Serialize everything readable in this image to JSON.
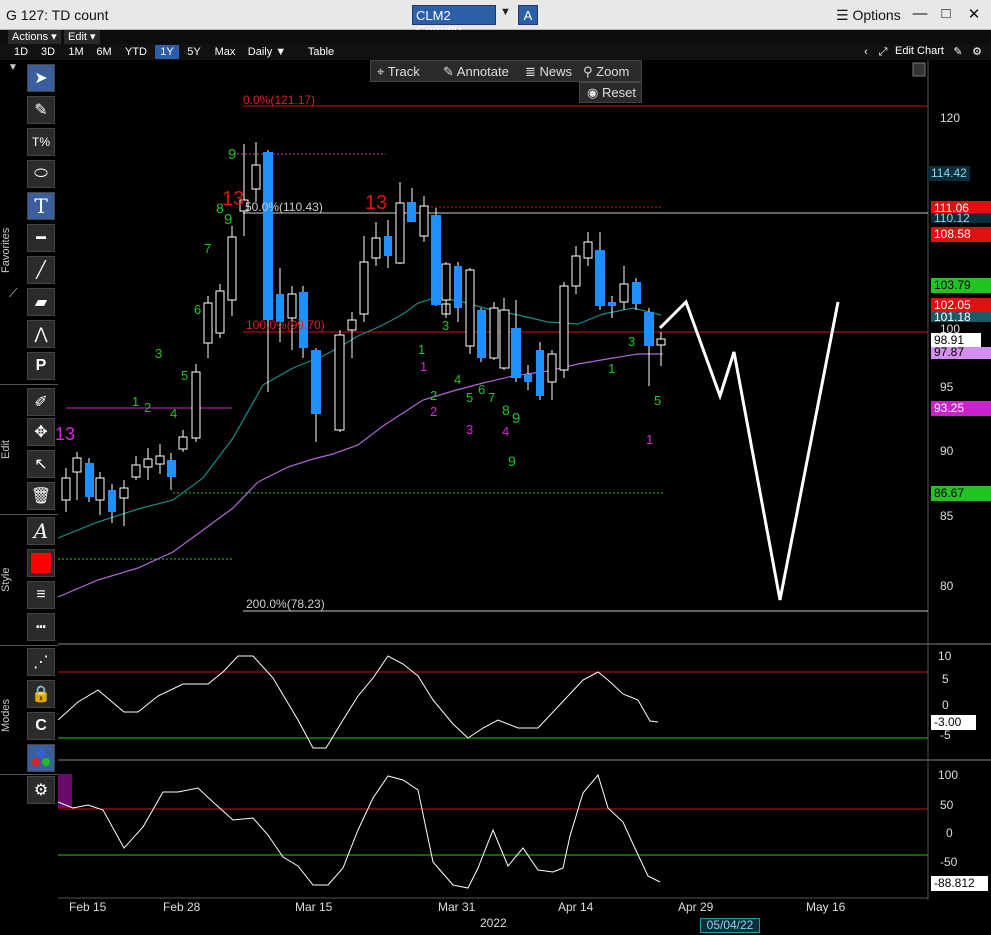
{
  "window": {
    "title": "G 127: TD count",
    "ticker": "CLM2 Comdty",
    "badge": "A",
    "options_label": "Options",
    "minimize_label": "□",
    "close_label": "✕"
  },
  "menu": {
    "actions": "Actions ▾",
    "edit": "Edit ▾"
  },
  "periods": [
    {
      "label": "1D"
    },
    {
      "label": "3D"
    },
    {
      "label": "1M"
    },
    {
      "label": "6M"
    },
    {
      "label": "YTD"
    },
    {
      "label": "1Y"
    },
    {
      "label": "5Y"
    },
    {
      "label": "Max"
    }
  ],
  "frequency": "Daily ▼",
  "table_label": "Table",
  "edit_chart_label": "Edit Chart",
  "toolbar_labels": {
    "favorites": "Favorites",
    "edit": "Edit",
    "style": "Style",
    "modes": "Modes"
  },
  "chart_tools": {
    "track": "Track",
    "annotate": "Annotate",
    "news": "News",
    "zoom": "Zoom",
    "reset": "Reset"
  },
  "fib_labels": [
    "0.0%(121.17)",
    "50.0%(110.43)",
    "100.0%(99.70)",
    "200.0%(78.23)"
  ],
  "price_ticks": [
    "120",
    "100",
    "95",
    "90",
    "85",
    "80"
  ],
  "price_tags": [
    {
      "value": "114.42",
      "fg": "#8fd4ee",
      "bg": "#0b2d3a"
    },
    {
      "value": "111.06",
      "fg": "#ffffff",
      "bg": "#e01010"
    },
    {
      "value": "110.12",
      "fg": "#8fd4ee",
      "bg": "#0b2d3a"
    },
    {
      "value": "108.58",
      "fg": "#ffffff",
      "bg": "#e01010"
    },
    {
      "value": "103.79",
      "fg": "#000000",
      "bg": "#22c422"
    },
    {
      "value": "102.05",
      "fg": "#ffffff",
      "bg": "#e01010"
    },
    {
      "value": "101.18",
      "fg": "#ffffff",
      "bg": "#1d5a66"
    },
    {
      "value": "98.91",
      "fg": "#000000",
      "bg": "#ffffff"
    },
    {
      "value": "97.87",
      "fg": "#000000",
      "bg": "#d48ef0"
    },
    {
      "value": "93.25",
      "fg": "#ffffff",
      "bg": "#cc22cc"
    },
    {
      "value": "86.67",
      "fg": "#000000",
      "bg": "#22c422"
    }
  ],
  "osc1_ticks": [
    "10",
    "5",
    "0",
    "-5"
  ],
  "osc1_tag": "-3.00",
  "osc2_ticks": [
    "100",
    "50",
    "0",
    "-50"
  ],
  "osc2_tag": "-88.812",
  "x_labels": [
    "Feb 15",
    "Feb 28",
    "Mar 15",
    "Mar 31",
    "Apr 14",
    "Apr 29",
    "May 16"
  ],
  "year_label": "2022",
  "date_box": "05/04/22",
  "td_labels": [
    {
      "t": "13",
      "c": "#e01010"
    },
    {
      "t": "13",
      "c": "#e01010"
    },
    {
      "t": "13",
      "c": "#e01010"
    },
    {
      "t": "13",
      "c": "#dd22dd"
    },
    {
      "t": "9",
      "c": "#22c422"
    },
    {
      "t": "9",
      "c": "#22c422"
    },
    {
      "t": "9",
      "c": "#22c422"
    },
    {
      "t": "9",
      "c": "#22c422"
    },
    {
      "t": "8",
      "c": "#22c422"
    },
    {
      "t": "8",
      "c": "#22c422"
    },
    {
      "t": "7",
      "c": "#22c422"
    },
    {
      "t": "7",
      "c": "#22c422"
    },
    {
      "t": "6",
      "c": "#22c422"
    },
    {
      "t": "6",
      "c": "#22c422"
    },
    {
      "t": "5",
      "c": "#22c422"
    },
    {
      "t": "5",
      "c": "#22c422"
    },
    {
      "t": "5",
      "c": "#22c422"
    },
    {
      "t": "4",
      "c": "#22c422"
    },
    {
      "t": "4",
      "c": "#22c422"
    },
    {
      "t": "4",
      "c": "#dd22dd"
    },
    {
      "t": "3",
      "c": "#22c422"
    },
    {
      "t": "3",
      "c": "#22c422"
    },
    {
      "t": "3",
      "c": "#22c422"
    },
    {
      "t": "3",
      "c": "#dd22dd"
    },
    {
      "t": "2",
      "c": "#22c422"
    },
    {
      "t": "2",
      "c": "#22c422"
    },
    {
      "t": "2",
      "c": "#dd22dd"
    },
    {
      "t": "1",
      "c": "#22c422"
    },
    {
      "t": "1",
      "c": "#22c422"
    },
    {
      "t": "1",
      "c": "#22c422"
    },
    {
      "t": "1",
      "c": "#dd22dd"
    },
    {
      "t": "1",
      "c": "#dd22dd"
    }
  ]
}
